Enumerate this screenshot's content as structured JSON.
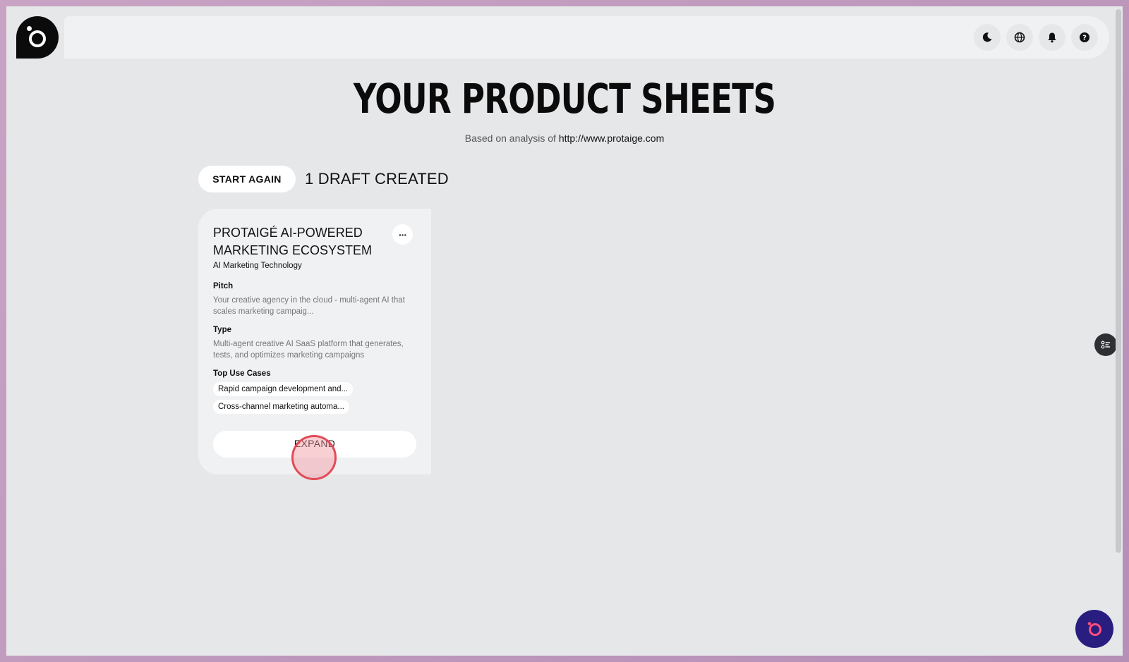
{
  "header": {
    "icons": [
      "theme-toggle-icon",
      "language-globe-icon",
      "notifications-bell-icon",
      "help-icon"
    ]
  },
  "page": {
    "title": "YOUR PRODUCT SHEETS",
    "subtitle_prefix": "Based on analysis of",
    "subtitle_url": "http://www.protaige.com"
  },
  "actions": {
    "start_again_label": "START AGAIN",
    "draft_count_text": "1 DRAFT CREATED"
  },
  "card": {
    "title": "PROTAIGÉ AI-POWERED MARKETING ECOSYSTEM",
    "more_label": "···",
    "category": "AI Marketing Technology",
    "pitch_label": "Pitch",
    "pitch_text": "Your creative agency in the cloud - multi-agent AI that scales marketing campaig...",
    "type_label": "Type",
    "type_text": "Multi-agent creative AI SaaS platform that generates, tests, and optimizes marketing campaigns",
    "use_cases_label": "Top Use Cases",
    "use_cases": [
      "Rapid campaign development and...",
      "Cross-channel marketing automa..."
    ],
    "expand_label": "EXPAND"
  },
  "colors": {
    "background": "#e6e7e9",
    "chat_button": "#2a1d80",
    "chat_accent": "#ff4f7a",
    "click_marker": "#e24b57"
  }
}
